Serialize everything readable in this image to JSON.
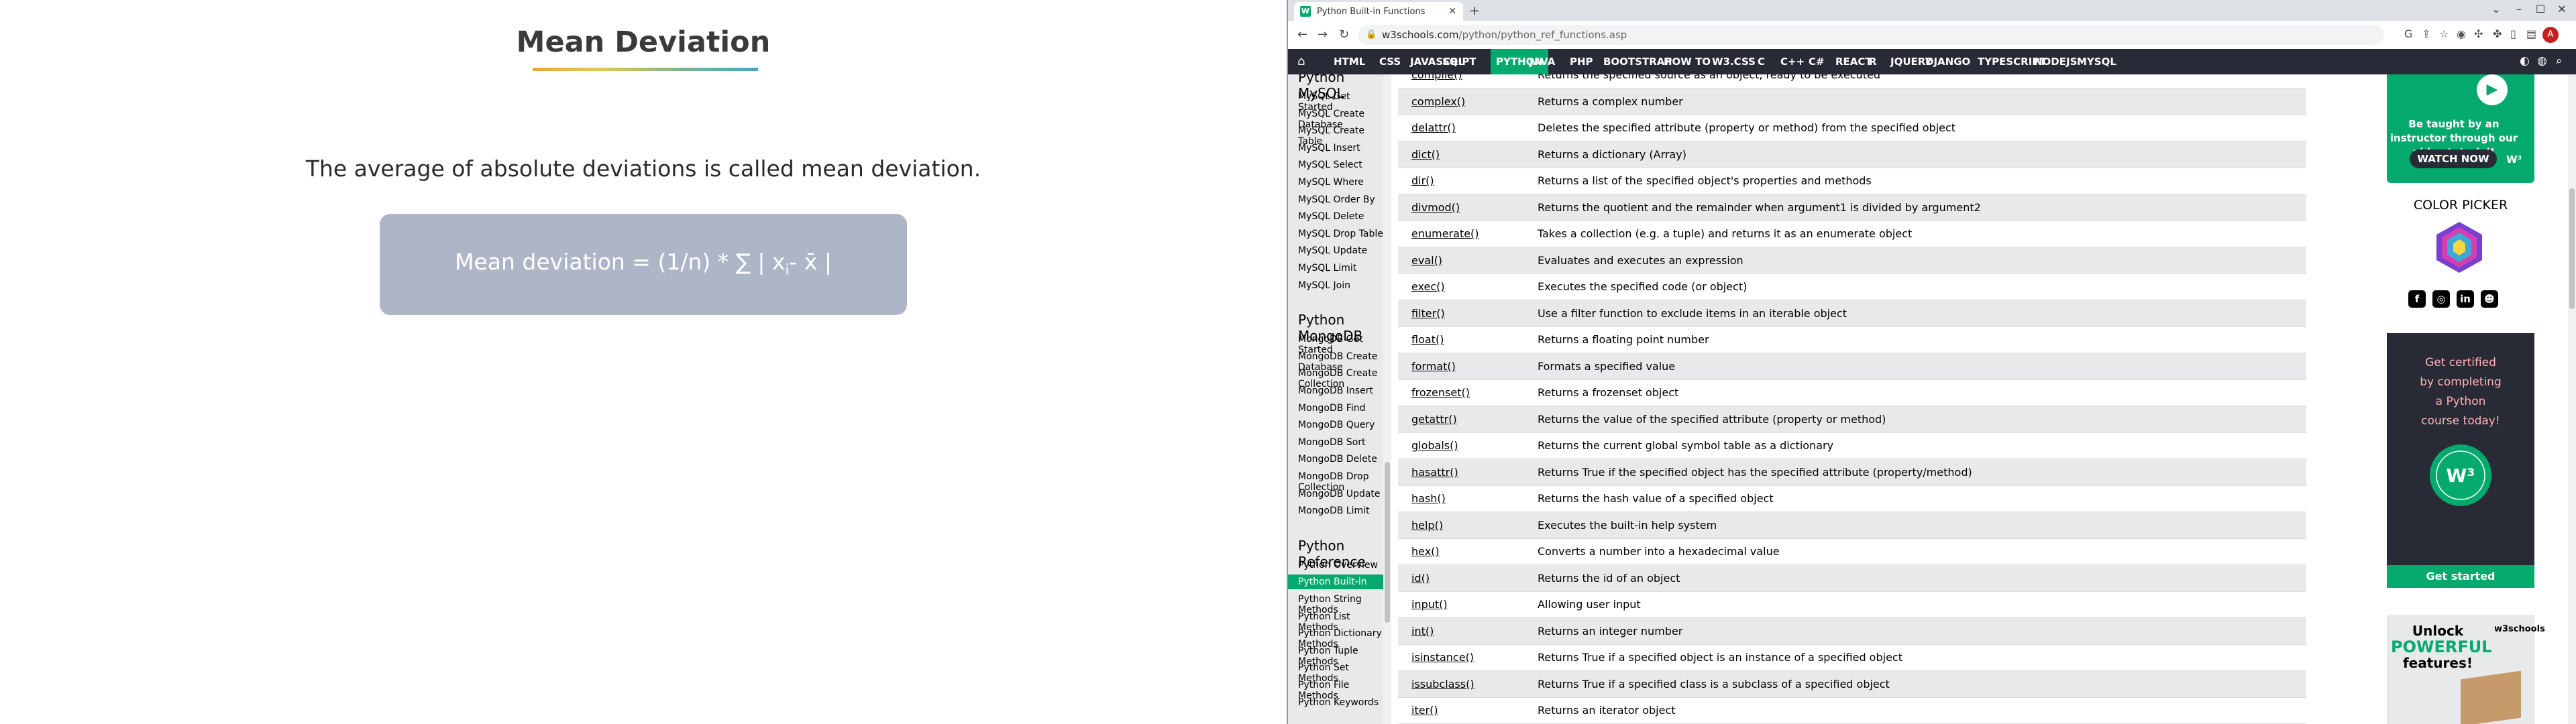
{
  "slide": {
    "title": "Mean Deviation",
    "description": "The average of absolute deviations is called mean deviation.",
    "formula_prefix": "Mean deviation = (1/n) * ∑ | x",
    "formula_sub": "i",
    "formula_suffix": "- x̄ |"
  },
  "browser": {
    "tab_title": "Python Built-in Functions",
    "favicon": "W",
    "url_domain": "w3schools.com",
    "url_path": "/python/python_ref_functions.asp",
    "avatar_letter": "A"
  },
  "w3nav": {
    "items": [
      "HTML",
      "CSS",
      "JAVASCRIPT",
      "SQL",
      "PYTHON",
      "JAVA",
      "PHP",
      "BOOTSTRAP",
      "HOW TO",
      "W3.CSS",
      "C",
      "C++",
      "C#",
      "REACT",
      "R",
      "JQUERY",
      "DJANGO",
      "TYPESCRIPT",
      "NODEJS",
      "MYSQL"
    ],
    "active": "PYTHON",
    "active_color": "#04aa6d"
  },
  "sidebar": {
    "groups": [
      {
        "heading": "Python MySQL",
        "items": [
          "MySQL Get Started",
          "MySQL Create Database",
          "MySQL Create Table",
          "MySQL Insert",
          "MySQL Select",
          "MySQL Where",
          "MySQL Order By",
          "MySQL Delete",
          "MySQL Drop Table",
          "MySQL Update",
          "MySQL Limit",
          "MySQL Join"
        ]
      },
      {
        "heading": "Python MongoDB",
        "items": [
          "MongoDB Get Started",
          "MongoDB Create Database",
          "MongoDB Create Collection",
          "MongoDB Insert",
          "MongoDB Find",
          "MongoDB Query",
          "MongoDB Sort",
          "MongoDB Delete",
          "MongoDB Drop Collection",
          "MongoDB Update",
          "MongoDB Limit"
        ]
      },
      {
        "heading": "Python Reference",
        "items": [
          "Python Overview",
          "Python Built-in Functions",
          "Python String Methods",
          "Python List Methods",
          "Python Dictionary Methods",
          "Python Tuple Methods",
          "Python Set Methods",
          "Python File Methods",
          "Python Keywords"
        ]
      }
    ],
    "active_item": "Python Built-in Functions"
  },
  "functions": [
    {
      "name": "compile()",
      "desc": "Returns the specified source as an object, ready to be executed"
    },
    {
      "name": "complex()",
      "desc": "Returns a complex number"
    },
    {
      "name": "delattr()",
      "desc": "Deletes the specified attribute (property or method) from the specified object"
    },
    {
      "name": "dict()",
      "desc": "Returns a dictionary (Array)"
    },
    {
      "name": "dir()",
      "desc": "Returns a list of the specified object's properties and methods"
    },
    {
      "name": "divmod()",
      "desc": "Returns the quotient and the remainder when argument1 is divided by argument2"
    },
    {
      "name": "enumerate()",
      "desc": "Takes a collection (e.g. a tuple) and returns it as an enumerate object"
    },
    {
      "name": "eval()",
      "desc": "Evaluates and executes an expression"
    },
    {
      "name": "exec()",
      "desc": "Executes the specified code (or object)"
    },
    {
      "name": "filter()",
      "desc": "Use a filter function to exclude items in an iterable object"
    },
    {
      "name": "float()",
      "desc": "Returns a floating point number"
    },
    {
      "name": "format()",
      "desc": "Formats a specified value"
    },
    {
      "name": "frozenset()",
      "desc": "Returns a frozenset object"
    },
    {
      "name": "getattr()",
      "desc": "Returns the value of the specified attribute (property or method)"
    },
    {
      "name": "globals()",
      "desc": "Returns the current global symbol table as a dictionary"
    },
    {
      "name": "hasattr()",
      "desc": "Returns True if the specified object has the specified attribute (property/method)"
    },
    {
      "name": "hash()",
      "desc": "Returns the hash value of a specified object"
    },
    {
      "name": "help()",
      "desc": "Executes the built-in help system"
    },
    {
      "name": "hex()",
      "desc": "Converts a number into a hexadecimal value"
    },
    {
      "name": "id()",
      "desc": "Returns the id of an object"
    },
    {
      "name": "input()",
      "desc": "Allowing user input"
    },
    {
      "name": "int()",
      "desc": "Returns an integer number"
    },
    {
      "name": "isinstance()",
      "desc": "Returns True if a specified object is an instance of a specified object"
    },
    {
      "name": "issubclass()",
      "desc": "Returns True if a specified class is a subclass of a specified object"
    },
    {
      "name": "iter()",
      "desc": "Returns an iterator object"
    }
  ],
  "ads": {
    "video_text": "Be taught by an instructor through our video tutorial!",
    "watch_now": "WATCH NOW",
    "color_picker": "COLOR PICKER",
    "cert_lines": [
      "Get certified",
      "by completing",
      "a Python",
      "course today!"
    ],
    "get_started": "Get started",
    "unlock_lines": [
      "Unlock",
      "POWERFUL",
      "features!"
    ],
    "w3_logo": "w3schools"
  }
}
